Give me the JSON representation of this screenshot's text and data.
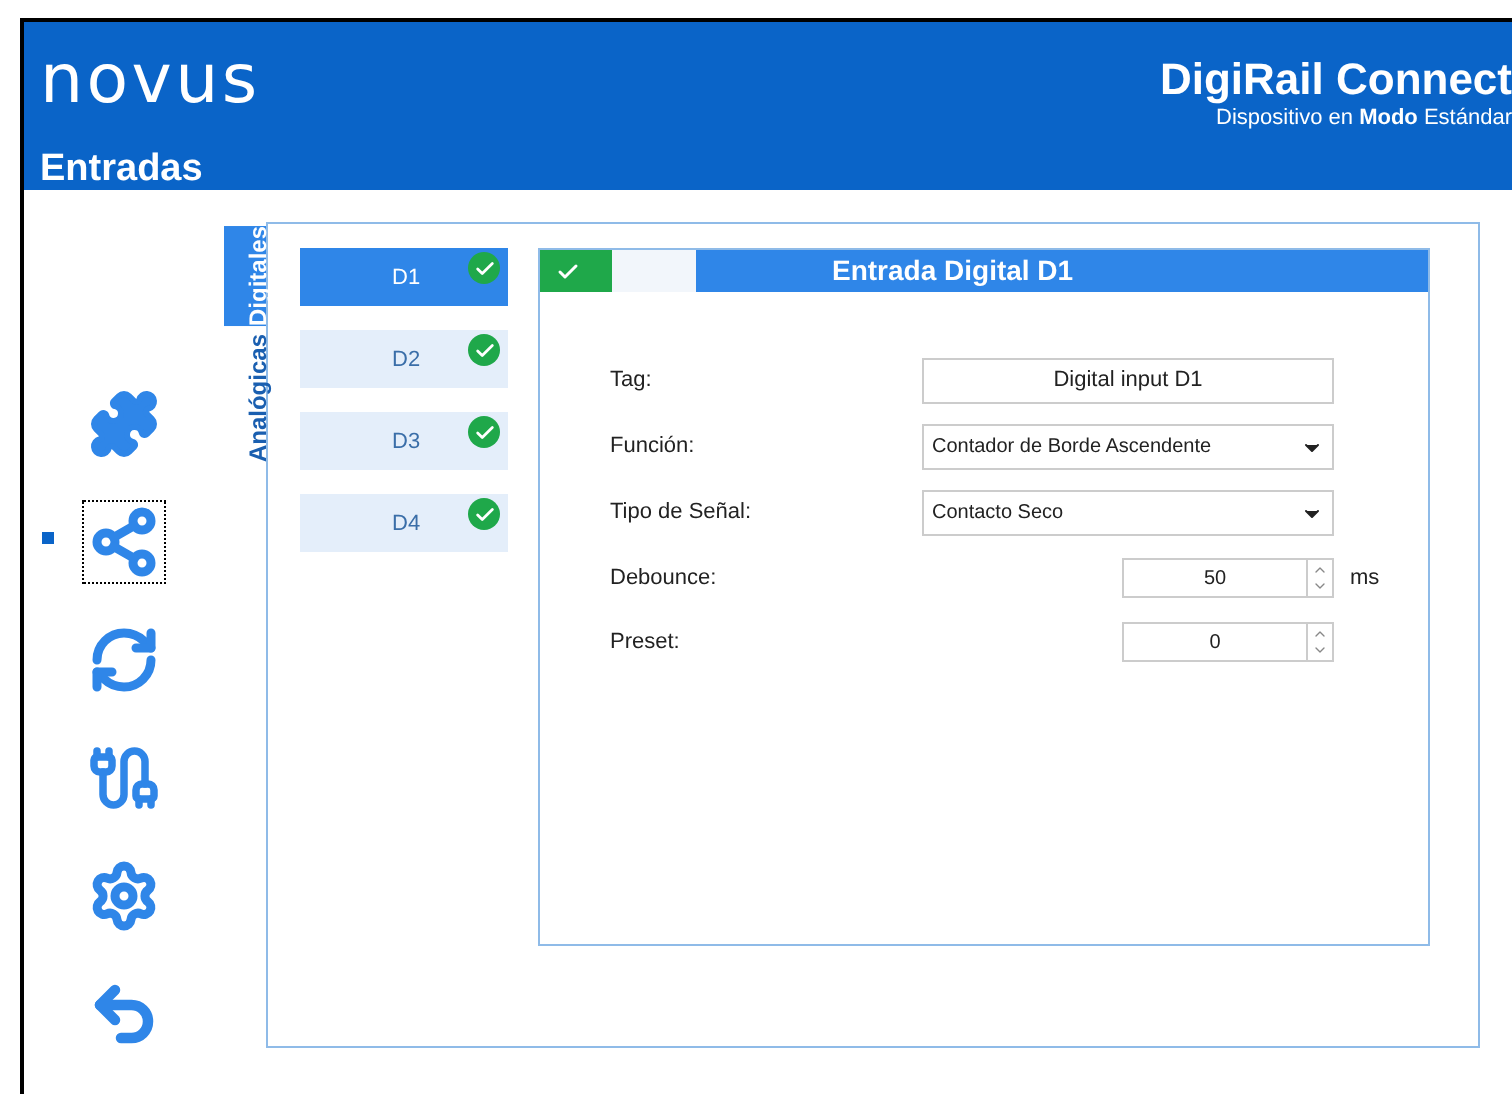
{
  "header": {
    "logo": "novus",
    "title": "DigiRail Connect",
    "subtitle": "Dispositivo en **Modo** Estándar",
    "page_title": "Entradas"
  },
  "sidebar": {
    "items": [
      {
        "kind": "puzzle",
        "selected": false
      },
      {
        "kind": "input",
        "selected": true
      },
      {
        "kind": "output",
        "selected": false
      },
      {
        "kind": "cable",
        "selected": false
      },
      {
        "kind": "settings",
        "selected": false
      },
      {
        "kind": "back",
        "selected": false
      }
    ]
  },
  "tabs": [
    {
      "label": "Digitales",
      "selected": true
    },
    {
      "label": "Analógicas",
      "selected": false
    }
  ],
  "channels": [
    {
      "label": "D1",
      "selected": true,
      "ok": true
    },
    {
      "label": "D2",
      "selected": false,
      "ok": true
    },
    {
      "label": "D3",
      "selected": false,
      "ok": true
    },
    {
      "label": "D4",
      "selected": false,
      "ok": true
    }
  ],
  "form": {
    "title": "Entrada Digital D1",
    "enabled": true,
    "fields": [
      {
        "kind": "text",
        "label": "Tag:",
        "value": "Digital input D1"
      },
      {
        "kind": "select",
        "label": "Función:",
        "value": "Contador de Borde Ascendente"
      },
      {
        "kind": "select",
        "label": "Tipo de Señal:",
        "value": "Contacto Seco"
      },
      {
        "kind": "number",
        "label": "Debounce:",
        "value": "50",
        "unit": "ms"
      },
      {
        "kind": "number",
        "label": "Preset:",
        "value": "0"
      }
    ]
  }
}
